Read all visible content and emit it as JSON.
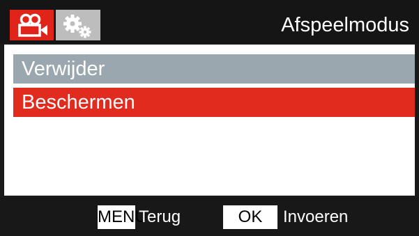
{
  "header": {
    "title": "Afspeelmodus",
    "tabs": [
      {
        "icon": "video-camera-icon",
        "active": true,
        "color": "#e1241a"
      },
      {
        "icon": "gears-icon",
        "active": false,
        "color": "#bdbdbd"
      }
    ]
  },
  "menu": {
    "items": [
      {
        "label": "Verwijder",
        "state": "normal",
        "color": "#9aa7ae"
      },
      {
        "label": "Beschermen",
        "state": "selected",
        "color": "#e02b1e"
      }
    ]
  },
  "footer": {
    "back_key": "MENU",
    "back_label": "Terug",
    "enter_key": "OK",
    "enter_label": "Invoeren"
  }
}
